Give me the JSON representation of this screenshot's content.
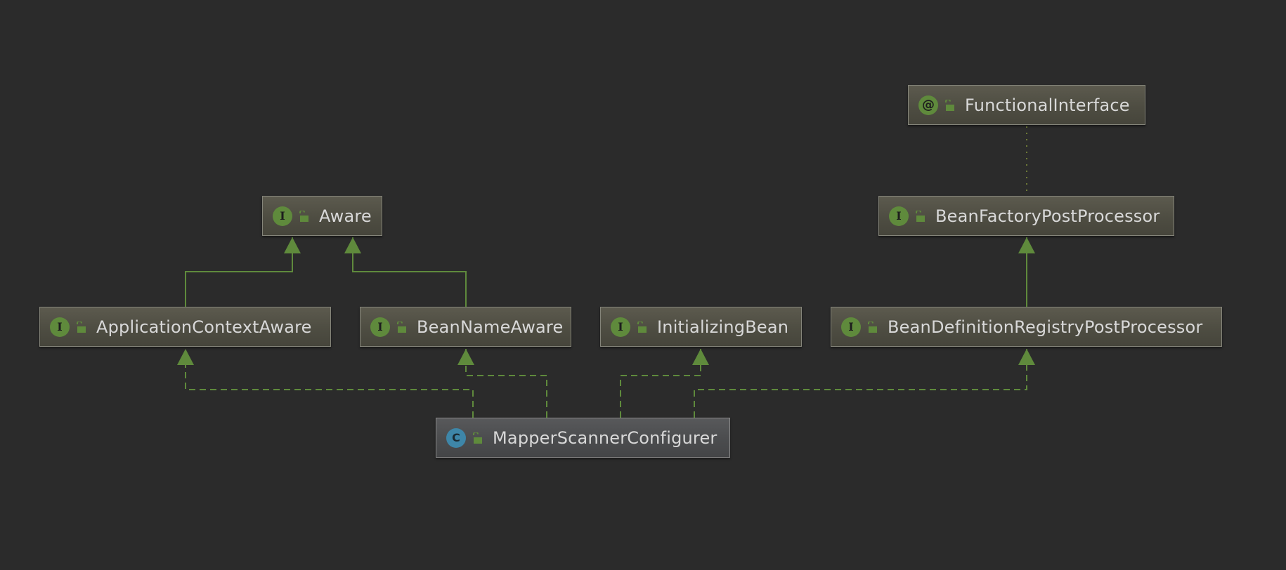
{
  "diagram": {
    "nodes": {
      "functional_interface": {
        "label": "FunctionalInterface",
        "kind_glyph": "@",
        "kind": "annotation"
      },
      "aware": {
        "label": "Aware",
        "kind_glyph": "I",
        "kind": "interface"
      },
      "bean_factory_post_processor": {
        "label": "BeanFactoryPostProcessor",
        "kind_glyph": "I",
        "kind": "interface"
      },
      "application_context_aware": {
        "label": "ApplicationContextAware",
        "kind_glyph": "I",
        "kind": "interface"
      },
      "bean_name_aware": {
        "label": "BeanNameAware",
        "kind_glyph": "I",
        "kind": "interface"
      },
      "initializing_bean": {
        "label": "InitializingBean",
        "kind_glyph": "I",
        "kind": "interface"
      },
      "bean_definition_registry_post_processor": {
        "label": "BeanDefinitionRegistryPostProcessor",
        "kind_glyph": "I",
        "kind": "interface"
      },
      "mapper_scanner_configurer": {
        "label": "MapperScannerConfigurer",
        "kind_glyph": "C",
        "kind": "class"
      }
    },
    "relations": [
      {
        "from": "application_context_aware",
        "to": "aware",
        "type": "extends"
      },
      {
        "from": "bean_name_aware",
        "to": "aware",
        "type": "extends"
      },
      {
        "from": "bean_definition_registry_post_processor",
        "to": "bean_factory_post_processor",
        "type": "extends"
      },
      {
        "from": "bean_factory_post_processor",
        "to": "functional_interface",
        "type": "annotated-with"
      },
      {
        "from": "mapper_scanner_configurer",
        "to": "application_context_aware",
        "type": "implements"
      },
      {
        "from": "mapper_scanner_configurer",
        "to": "bean_name_aware",
        "type": "implements"
      },
      {
        "from": "mapper_scanner_configurer",
        "to": "initializing_bean",
        "type": "implements"
      },
      {
        "from": "mapper_scanner_configurer",
        "to": "bean_definition_registry_post_processor",
        "type": "implements"
      }
    ],
    "colors": {
      "background": "#2b2b2b",
      "edge": "#5f8a3c",
      "annotation_edge": "#6e7a38",
      "interface_badge": "#5f8a3c",
      "class_badge": "#3e86a8",
      "label_text": "#d8d8d8"
    },
    "icons": {
      "visibility": "unlocked-padlock-icon"
    }
  }
}
